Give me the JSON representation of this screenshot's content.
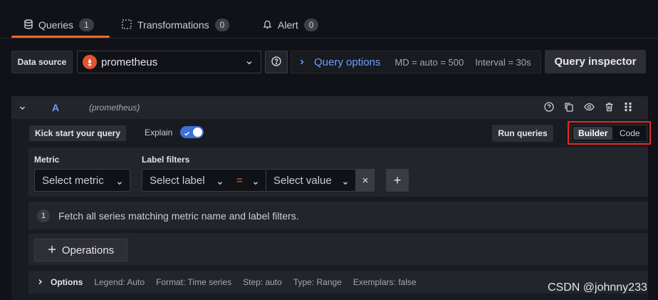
{
  "tabs": [
    {
      "label": "Queries",
      "count": "1",
      "icon": "database-icon"
    },
    {
      "label": "Transformations",
      "count": "0",
      "icon": "transform-icon"
    },
    {
      "label": "Alert",
      "count": "0",
      "icon": "bell-icon"
    }
  ],
  "toolbar": {
    "datasource_label": "Data source",
    "datasource_value": "prometheus",
    "query_options_label": "Query options",
    "md": "MD = auto = 500",
    "interval": "Interval = 30s",
    "query_inspector": "Query inspector"
  },
  "query": {
    "letter": "A",
    "datasource": "(prometheus)",
    "kick_start": "Kick start your query",
    "explain": "Explain",
    "explain_on": true,
    "run_queries": "Run queries",
    "mode_builder": "Builder",
    "mode_code": "Code",
    "metric_label": "Metric",
    "metric_placeholder": "Select metric",
    "label_filters_label": "Label filters",
    "label_placeholder": "Select label",
    "operator": "=",
    "value_placeholder": "Select value",
    "remove": "×",
    "add": "+",
    "hint_number": "1",
    "hint_text": "Fetch all series matching metric name and label filters.",
    "operations": "Operations",
    "options_title": "Options",
    "options_legend": "Legend: Auto",
    "options_format": "Format: Time series",
    "options_step": "Step: auto",
    "options_type": "Type: Range",
    "options_exemplars": "Exemplars: false"
  },
  "watermark": "CSDN @johnny233",
  "colors": {
    "accent": "#f2672a",
    "link": "#6e9fff",
    "highlight": "#e8262a",
    "toggle": "#3d71d9"
  }
}
